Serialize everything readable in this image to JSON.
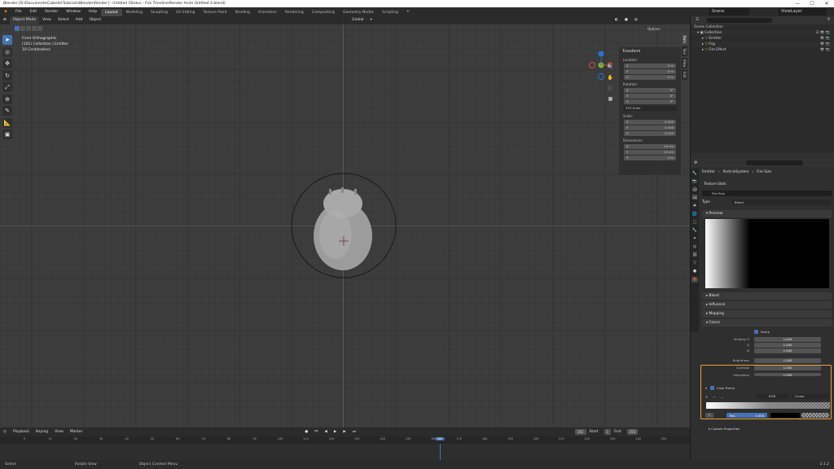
{
  "window": {
    "title": "Blender [D:\\Documents\\Cabiste\\Tutorials\\Blender\\Render] - Untitled (Status - Fire Timeline/Render Anim Untitled-2.blend)",
    "buttons": [
      "—",
      "☐",
      "✕"
    ]
  },
  "menubar": {
    "menus": [
      "File",
      "Edit",
      "Render",
      "Window",
      "Help"
    ],
    "workspaces": [
      "Layout",
      "Modeling",
      "Sculpting",
      "UV Editing",
      "Texture Paint",
      "Shading",
      "Animation",
      "Rendering",
      "Compositing",
      "Geometry Nodes",
      "Scripting"
    ],
    "active_workspace": "Layout",
    "scene_label": "Scene",
    "view_layer_label": "ViewLayer"
  },
  "viewport": {
    "mode": "Object Mode",
    "menus": [
      "View",
      "Select",
      "Add",
      "Object"
    ],
    "orientation": "Global",
    "overlay_lines": [
      "Front Orthographic",
      "(101) Collection | Emitter",
      "10 Centimeters"
    ],
    "options_label": "Options"
  },
  "npanel": {
    "title": "Transform",
    "location_label": "Location:",
    "location": [
      [
        "X",
        "0 m"
      ],
      [
        "Y",
        "0 m"
      ],
      [
        "Z",
        "0 m"
      ]
    ],
    "rotation_label": "Rotation:",
    "rotation": [
      [
        "X",
        "0°"
      ],
      [
        "Y",
        "0°"
      ],
      [
        "Z",
        "0°"
      ]
    ],
    "rotation_mode": "XYZ Euler",
    "scale_label": "Scale:",
    "scale": [
      [
        "X",
        "0.100"
      ],
      [
        "Y",
        "0.100"
      ],
      [
        "Z",
        "0.100"
      ]
    ],
    "dimensions_label": "Dimensions:",
    "dimensions": [
      [
        "X",
        "10 cm"
      ],
      [
        "Y",
        "10 cm"
      ],
      [
        "Z",
        "0 m"
      ]
    ],
    "tabs": [
      "Item",
      "Tool",
      "View",
      "Edit"
    ]
  },
  "timeline": {
    "menus": [
      "Playback",
      "Keying",
      "View",
      "Marker"
    ],
    "current_frame": "162",
    "start_label": "Start",
    "start": "1",
    "end_label": "End",
    "end": "250",
    "ticks": [
      "0",
      "10",
      "20",
      "30",
      "40",
      "50",
      "60",
      "70",
      "80",
      "90",
      "100",
      "110",
      "120",
      "130",
      "140",
      "150",
      "160",
      "170",
      "180",
      "190",
      "200",
      "210",
      "220",
      "230",
      "240",
      "250"
    ],
    "playhead_tick": "162"
  },
  "statusbar": {
    "items": [
      "Select",
      "Rotate View",
      "Object Context Menu"
    ],
    "version": "3.1.2"
  },
  "outliner": {
    "title": "Scene Collection",
    "rows": [
      {
        "name": "Collection",
        "indent": 1
      },
      {
        "name": "Emitter",
        "indent": 2
      },
      {
        "name": "Fog",
        "indent": 2
      },
      {
        "name": "Fire Effect",
        "indent": 2
      }
    ]
  },
  "properties": {
    "breadcrumb": [
      "Emitter",
      "ParticleSystem",
      "Fire Size"
    ],
    "texture_header": "Texture Slots",
    "texture_name": "Fire Size",
    "type_label": "Type",
    "type_value": "Blend",
    "panels": [
      "Preview",
      "Blend",
      "Influence",
      "Mapping",
      "Colors"
    ],
    "colors": {
      "ramp_label": "Ramp",
      "multiply_r_label": "Multiply R",
      "multiply_r": "1.000",
      "g_label": "G",
      "g": "1.000",
      "b_label": "B",
      "b": "1.000",
      "brightness_label": "Brightness",
      "brightness": "1.000",
      "contrast_label": "Contrast",
      "contrast": "1.000",
      "saturation_label": "Saturation",
      "saturation": "1.000"
    },
    "color_ramp": {
      "header": "Color Ramp",
      "mode": "RGB",
      "interpolation": "Linear",
      "index": "1",
      "pos_label": "Pos",
      "pos": "1.000"
    },
    "custom_header": "Custom Properties",
    "accent": "#4772b3",
    "highlight": "#e8a33a"
  }
}
